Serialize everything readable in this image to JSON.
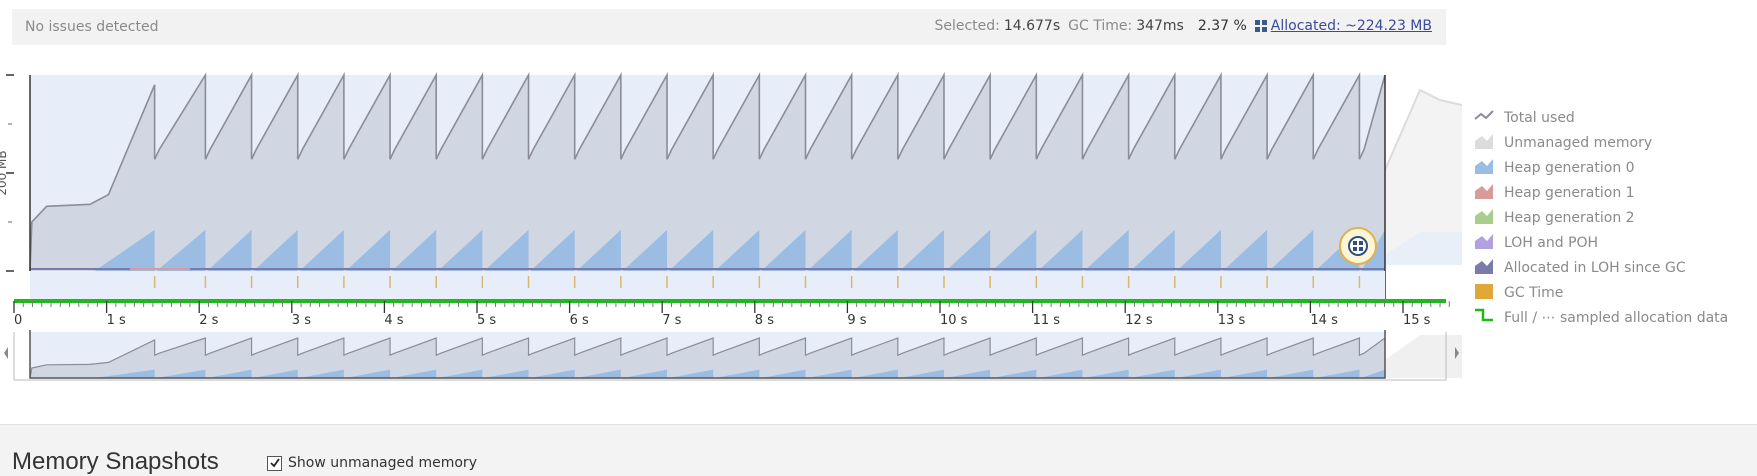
{
  "status": {
    "issues": "No issues detected",
    "selected_label": "Selected:",
    "selected_value": "14.677s",
    "gc_label": "GC Time:",
    "gc_value": "347ms",
    "gc_percent": "2.37 %",
    "allocated": "Allocated: ~224.23 MB"
  },
  "chart": {
    "y_label": "200 MB",
    "x_ticks": [
      "0",
      "1 s",
      "2 s",
      "3 s",
      "4 s",
      "5 s",
      "6 s",
      "7 s",
      "8 s",
      "9 s",
      "10 s",
      "11 s",
      "12 s",
      "13 s",
      "14 s",
      "15 s"
    ],
    "gc_event_times_s": [
      1.35,
      1.9,
      2.4,
      2.9,
      3.4,
      3.9,
      4.4,
      4.9,
      5.4,
      5.9,
      6.4,
      6.9,
      7.4,
      7.9,
      8.4,
      8.9,
      9.4,
      9.9,
      10.4,
      10.9,
      11.4,
      11.9,
      12.4,
      12.9,
      13.4,
      13.9,
      14.4
    ],
    "selection_end_s": 14.677
  },
  "legend": [
    {
      "label": "Total used",
      "icon": "line-zigzag",
      "color": "#8a8d99"
    },
    {
      "label": "Unmanaged memory",
      "icon": "area",
      "color": "#dcdcdc"
    },
    {
      "label": "Heap generation 0",
      "icon": "area",
      "color": "#9bbde4"
    },
    {
      "label": "Heap generation 1",
      "icon": "area",
      "color": "#d99a9a"
    },
    {
      "label": "Heap generation 2",
      "icon": "area",
      "color": "#a8cd8c"
    },
    {
      "label": "LOH and POH",
      "icon": "area",
      "color": "#b3a0e0"
    },
    {
      "label": "Allocated in LOH since GC",
      "icon": "area",
      "color": "#7b7aa8"
    },
    {
      "label": "GC Time",
      "icon": "block",
      "color": "#e0a838"
    },
    {
      "label": "Full / ⋯ sampled allocation data",
      "icon": "step-line",
      "color": "#1fb81f"
    }
  ],
  "snapshots": {
    "title": "Memory Snapshots",
    "show_unmanaged_label": "Show unmanaged memory",
    "show_unmanaged_checked": true
  }
}
